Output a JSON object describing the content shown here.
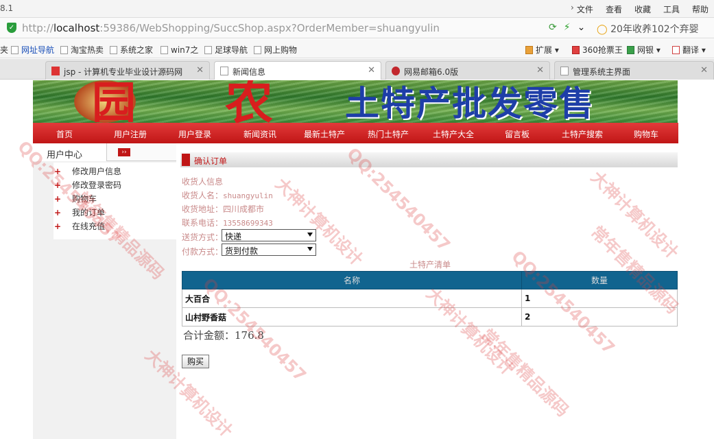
{
  "browser": {
    "version": "8.1",
    "menus": [
      "文件",
      "查看",
      "收藏",
      "工具",
      "帮助"
    ],
    "address": {
      "host": "localhost",
      "prefix": "http://",
      "rest": ":59386/WebShopping/SuccShop.aspx?OrderMember=shuangyulin"
    },
    "search_hint": "20年收养102个弃婴",
    "bookmarks": [
      "网址导航",
      "淘宝热卖",
      "系统之家",
      "win7之",
      "足球导航",
      "网上购物"
    ],
    "bookmark_tools": [
      "扩展",
      "360抢票王",
      "网银",
      "翻译"
    ],
    "tabs": [
      {
        "label": "jsp - 计算机专业毕业设计源码网"
      },
      {
        "label": "新闻信息"
      },
      {
        "label": "网易邮箱6.0版"
      },
      {
        "label": "管理系统主界面"
      }
    ]
  },
  "site": {
    "banner_slogan": "土特产批发零售",
    "nav": [
      "首页",
      "用户注册",
      "用户登录",
      "新闻资讯",
      "最新土特产",
      "热门土特产",
      "土特产大全",
      "留言板",
      "土特产搜索",
      "购物车"
    ],
    "sidebar": {
      "title": "用户中心",
      "items": [
        "修改用户信息",
        "修改登录密码",
        "购物车",
        "我的订单",
        "在线充值"
      ]
    },
    "order": {
      "section_title": "确认订单",
      "receiver_header": "收货人信息",
      "name_label": "收货人名：",
      "name_value": "shuangyulin",
      "address_label": "收货地址：",
      "address_value": "四川成都市",
      "phone_label": "联系电话：",
      "phone_value": "13558699343",
      "shipping_label": "送货方式：",
      "shipping_value": "快递",
      "payment_label": "付款方式：",
      "payment_value": "货到付款",
      "list_caption": "土特产清单",
      "columns": [
        "名称",
        "数量"
      ],
      "rows": [
        {
          "name": "大百合",
          "qty": "1"
        },
        {
          "name": "山村野香菇",
          "qty": "2"
        }
      ],
      "total_label": "合计金额：",
      "total_value": "176.8",
      "buy_label": "购买"
    }
  },
  "watermarks": [
    "QQ:254540457",
    "大神计算机设计",
    "常年售精品源码"
  ]
}
